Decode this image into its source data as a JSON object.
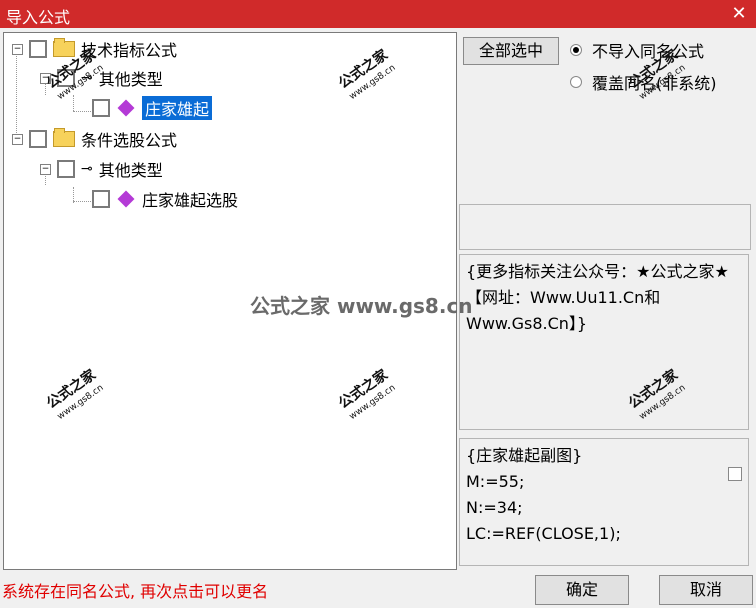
{
  "window": {
    "title": "导入公式"
  },
  "tree": {
    "nodes": [
      {
        "label": "技术指标公式"
      },
      {
        "label": "其他类型"
      },
      {
        "label": "庄家雄起"
      },
      {
        "label": "条件选股公式"
      },
      {
        "label": "其他类型"
      },
      {
        "label": "庄家雄起选股"
      }
    ]
  },
  "buttons": {
    "select_all": "全部选中",
    "ok": "确定",
    "cancel": "取消"
  },
  "options": {
    "no_import": "不导入同名公式",
    "overwrite": "覆盖同名(非系统)"
  },
  "info_text": "{更多指标关注公众号：★公式之家★ 【网址：Www.Uu11.Cn和Www.Gs8.Cn】}",
  "code": {
    "lines": [
      "{庄家雄起副图}",
      "M:=55;",
      "N:=34;",
      "LC:=REF(CLOSE,1);"
    ]
  },
  "status": "系统存在同名公式, 再次点击可以更名",
  "watermark": {
    "main": "公式之家 www.gs8.cn",
    "line1": "公式之家",
    "line2": "www.gs8.cn"
  }
}
